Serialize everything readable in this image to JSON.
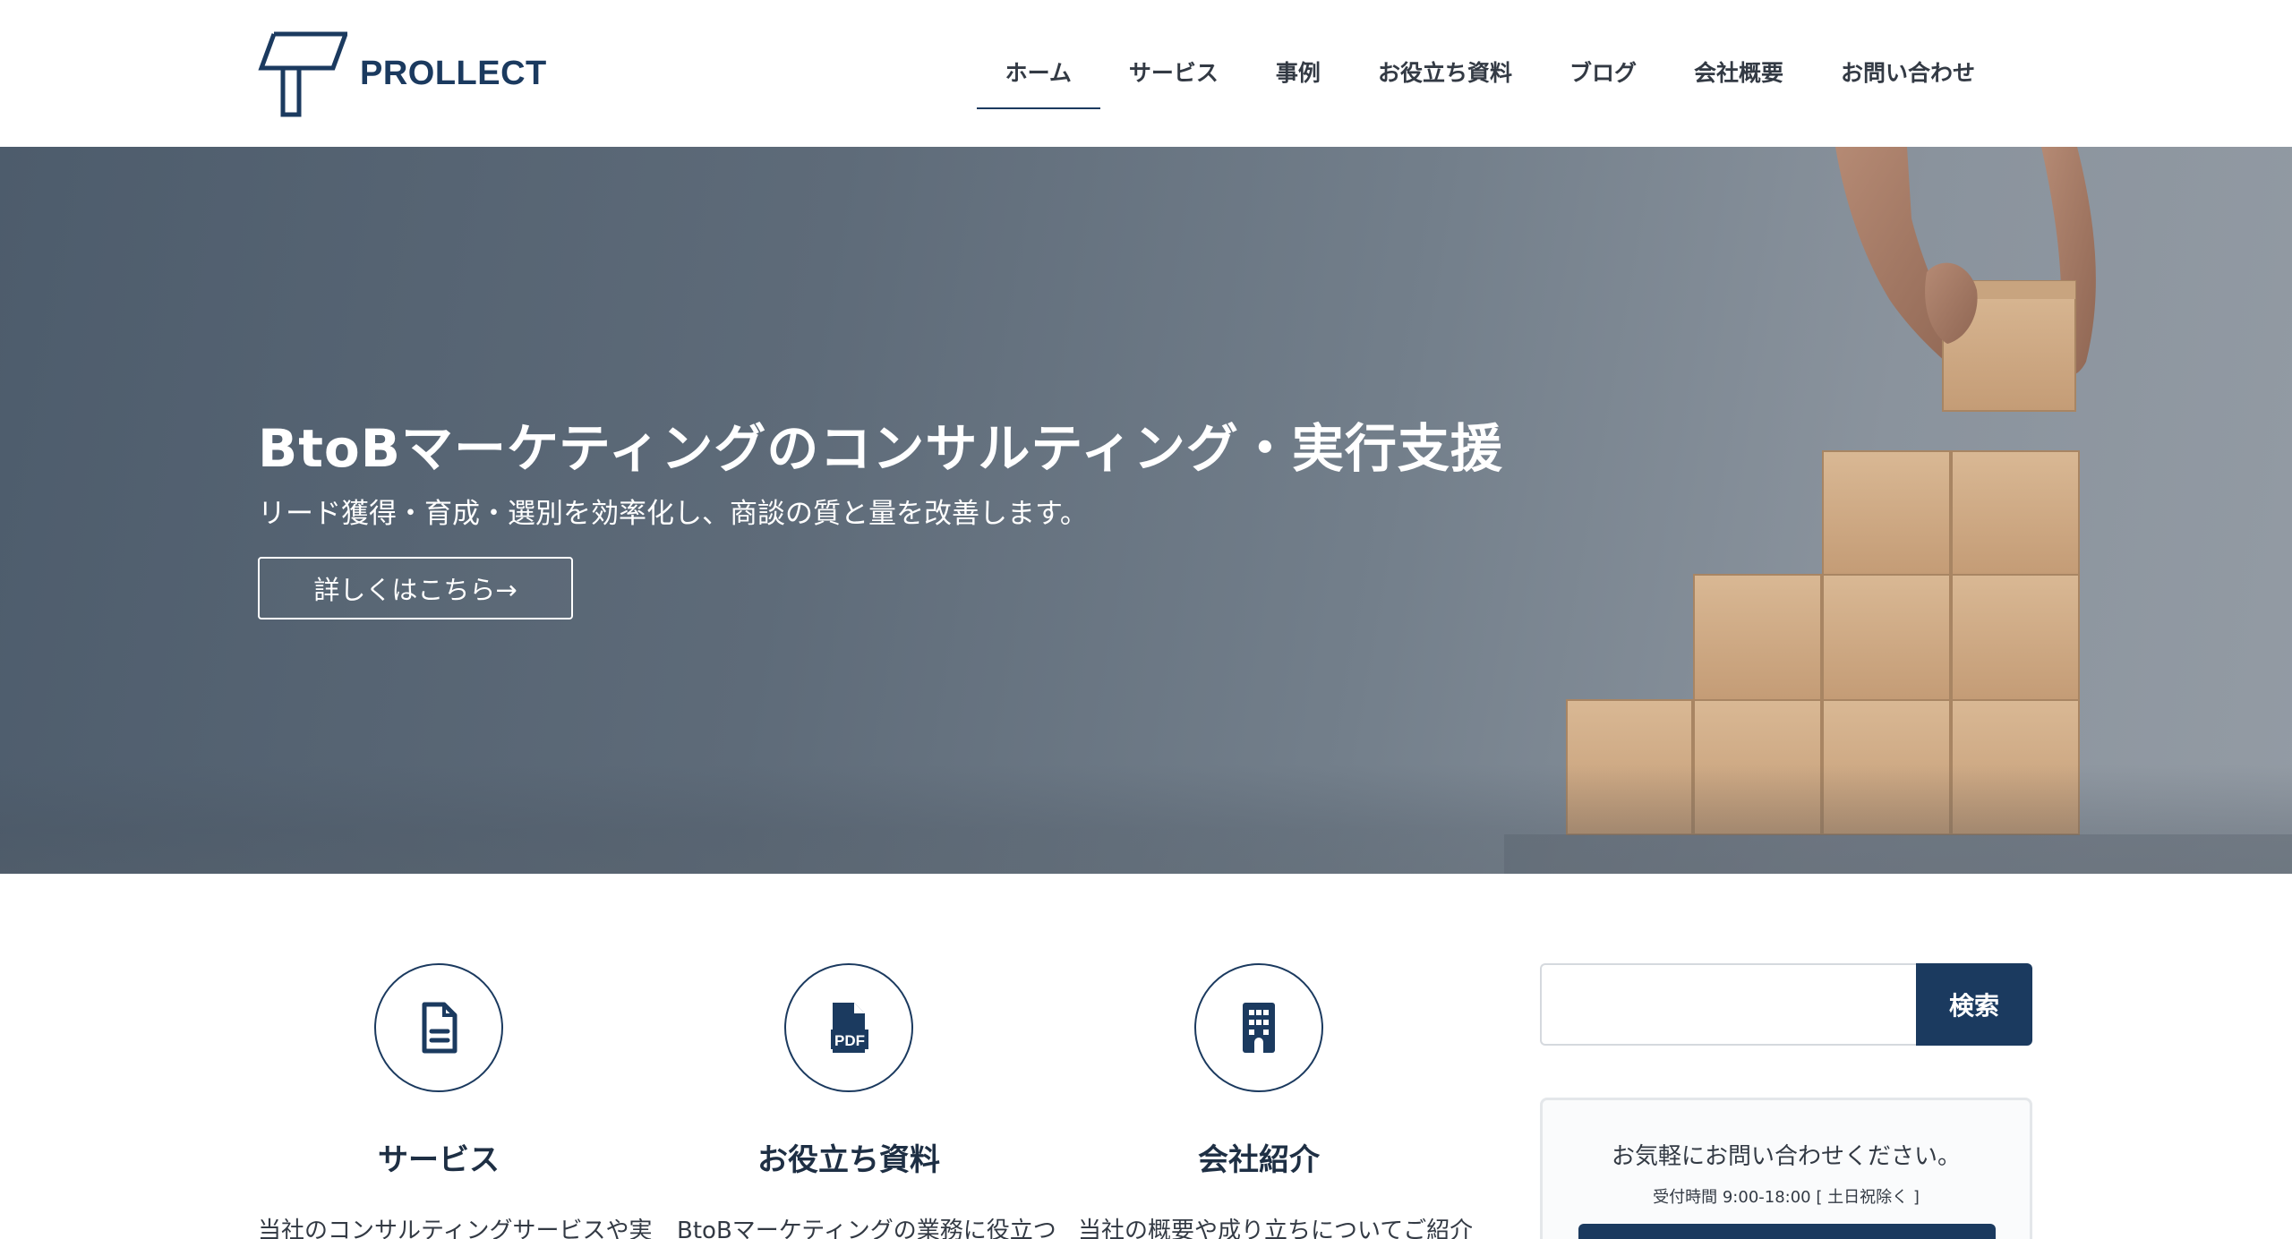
{
  "brand": {
    "name": "PROLLECT",
    "color": "#1b3a5f"
  },
  "nav": {
    "items": [
      {
        "label": "ホーム",
        "active": true
      },
      {
        "label": "サービス"
      },
      {
        "label": "事例"
      },
      {
        "label": "お役立ち資料"
      },
      {
        "label": "ブログ"
      },
      {
        "label": "会社概要"
      },
      {
        "label": "お問い合わせ"
      }
    ]
  },
  "hero": {
    "title": "BtoBマーケティングのコンサルティング・実行支援",
    "subtitle": "リード獲得・育成・選別を効率化し、商談の質と量を改善します。",
    "button_label": "詳しくはこちら→"
  },
  "features": [
    {
      "icon": "document-icon",
      "title": "サービス",
      "text": "当社のコンサルティングサービスや実"
    },
    {
      "icon": "pdf-icon",
      "title": "お役立ち資料",
      "text": "BtoBマーケティングの業務に役立つ"
    },
    {
      "icon": "building-icon",
      "title": "会社紹介",
      "text": "当社の概要や成り立ちについてご紹介"
    }
  ],
  "sidebar": {
    "search": {
      "placeholder": "",
      "button_label": "検索"
    },
    "contact": {
      "title": "お気軽にお問い合わせください。",
      "hours": "受付時間 9:00-18:00 [ 土日祝除く ]"
    }
  }
}
